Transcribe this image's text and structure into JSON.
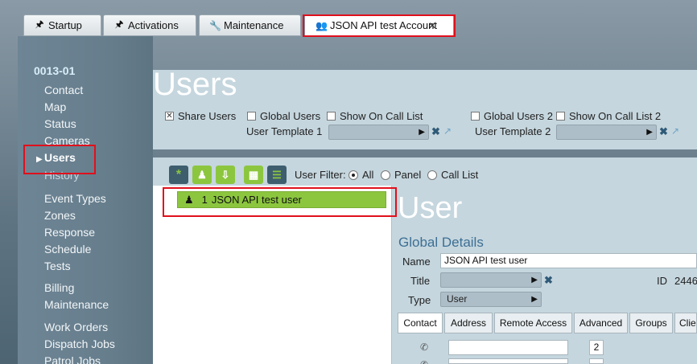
{
  "tabs": [
    {
      "label": "Startup",
      "icon": "pin-icon"
    },
    {
      "label": "Activations",
      "icon": "pin-icon"
    },
    {
      "label": "Maintenance",
      "icon": "wrench-icon"
    },
    {
      "label": "JSON API test Account",
      "icon": "account-icon",
      "close": "✕"
    }
  ],
  "sidebar": {
    "account_id": "0013-01",
    "items": [
      "Contact",
      "Map",
      "Status",
      "Cameras",
      "Users",
      "History",
      "Event Types",
      "Zones",
      "Response",
      "Schedule",
      "Tests",
      "Billing",
      "Maintenance",
      "Work Orders",
      "Dispatch Jobs",
      "Patrol Jobs"
    ],
    "selected": "Users"
  },
  "users": {
    "title": "Users",
    "share_users": "Share Users",
    "global_users": "Global Users",
    "show_on_call_list": "Show On Call List",
    "user_template_1": "User Template 1",
    "global_users_2": "Global Users 2",
    "show_on_call_list_2": "Show On Call List 2",
    "user_template_2": "User Template 2"
  },
  "list": {
    "filter_label": "User Filter:",
    "filter_options": [
      "All",
      "Panel",
      "Call List"
    ],
    "filter_selected": "All",
    "rows": [
      {
        "number": "1",
        "name": "JSON API test user"
      }
    ]
  },
  "detail": {
    "title": "User",
    "section": "Global Details",
    "name_label": "Name",
    "name_value": "JSON API test user",
    "title_label": "Title",
    "id_label": "ID",
    "id_value": "2446",
    "type_label": "Type",
    "type_value": "User",
    "tabs": [
      "Contact",
      "Address",
      "Remote Access",
      "Advanced",
      "Groups",
      "Clie"
    ],
    "contact_value_1": "2"
  },
  "colors": {
    "accent_green": "#8cc63f",
    "highlight_red": "#e0101c",
    "heading_blue": "#3d6f94"
  }
}
